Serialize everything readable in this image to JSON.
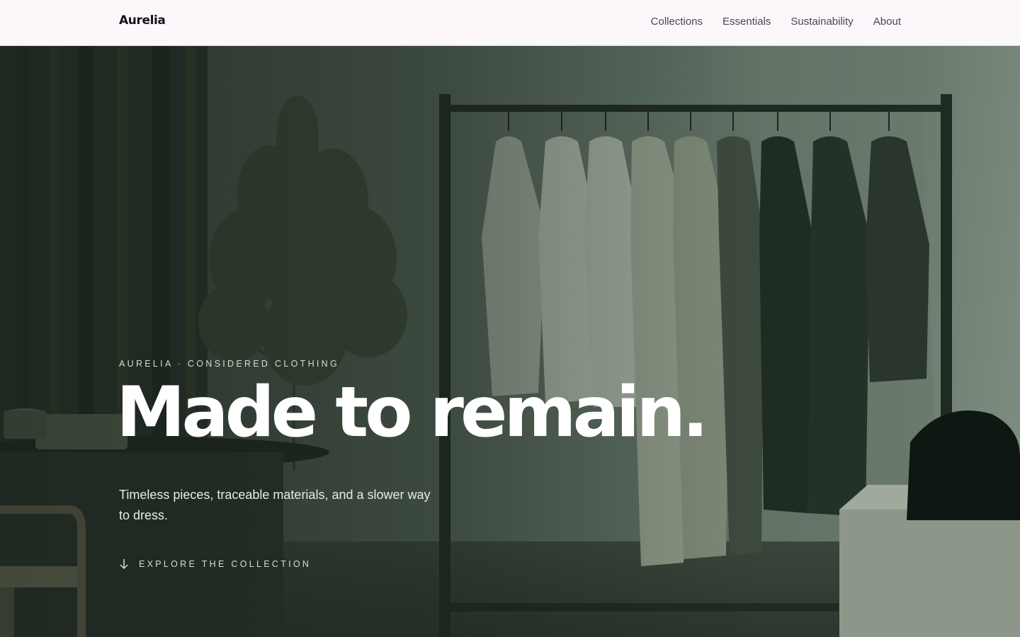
{
  "header": {
    "brand": "Aurelia",
    "nav": [
      {
        "label": "Collections"
      },
      {
        "label": "Essentials"
      },
      {
        "label": "Sustainability"
      },
      {
        "label": "About"
      }
    ]
  },
  "hero": {
    "eyebrow": "AURELIA · CONSIDERED CLOTHING",
    "headline": "Made to remain.",
    "subtitle": "Timeless pieces, traceable materials, and a slower way to dress.",
    "cta": {
      "label": "EXPLORE THE COLLECTION",
      "icon": "arrow-down-icon"
    }
  },
  "colors": {
    "header_bg": "#fcf7fb",
    "brand": "#17131a",
    "nav_text": "#4a4650",
    "hero_tint": "#4a5c4c",
    "headline": "#ffffff"
  }
}
